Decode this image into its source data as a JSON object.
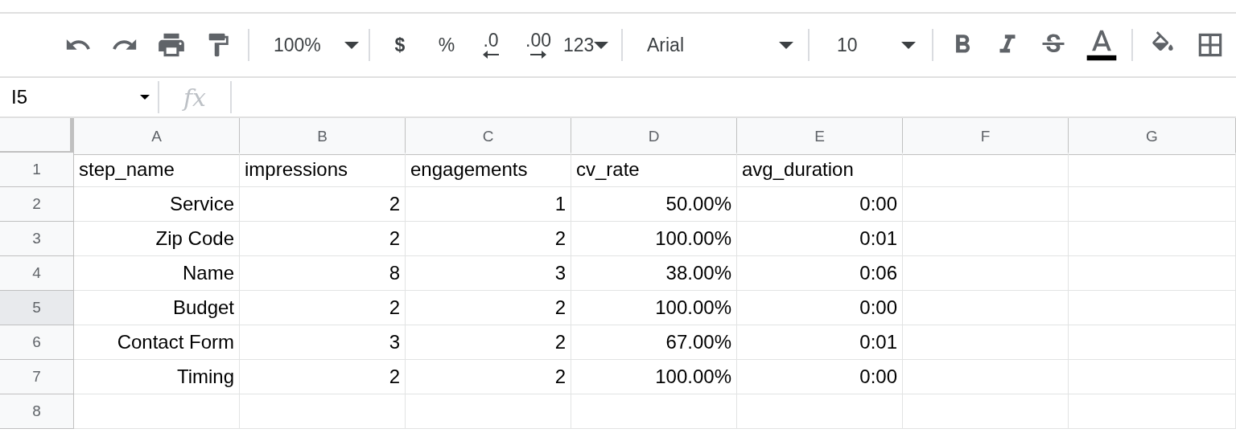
{
  "toolbar": {
    "zoom": "100%",
    "currency": "$",
    "percent": "%",
    "decrease_decimals": ".0",
    "increase_decimals": ".00",
    "more_formats": "123",
    "font": "Arial",
    "font_size": "10"
  },
  "formula_bar": {
    "name_box": "I5",
    "fx_label": "fx"
  },
  "sheet": {
    "columns": [
      "A",
      "B",
      "C",
      "D",
      "E",
      "F",
      "G"
    ],
    "rows": [
      {
        "number": "1",
        "selected": false,
        "kind": "header",
        "cells": [
          "step_name",
          "impressions",
          "engagements",
          "cv_rate",
          "avg_duration"
        ]
      },
      {
        "number": "2",
        "selected": false,
        "kind": "data",
        "cells": [
          "Service",
          "2",
          "1",
          "50.00%",
          "0:00"
        ]
      },
      {
        "number": "3",
        "selected": false,
        "kind": "data",
        "cells": [
          "Zip Code",
          "2",
          "2",
          "100.00%",
          "0:01"
        ]
      },
      {
        "number": "4",
        "selected": false,
        "kind": "data",
        "cells": [
          "Name",
          "8",
          "3",
          "38.00%",
          "0:06"
        ]
      },
      {
        "number": "5",
        "selected": true,
        "kind": "data",
        "cells": [
          "Budget",
          "2",
          "2",
          "100.00%",
          "0:00"
        ]
      },
      {
        "number": "6",
        "selected": false,
        "kind": "data",
        "cells": [
          "Contact Form",
          "3",
          "2",
          "67.00%",
          "0:01"
        ]
      },
      {
        "number": "7",
        "selected": false,
        "kind": "data",
        "cells": [
          "Timing",
          "2",
          "2",
          "100.00%",
          "0:00"
        ]
      },
      {
        "number": "8",
        "selected": false,
        "kind": "data",
        "cells": []
      }
    ]
  }
}
